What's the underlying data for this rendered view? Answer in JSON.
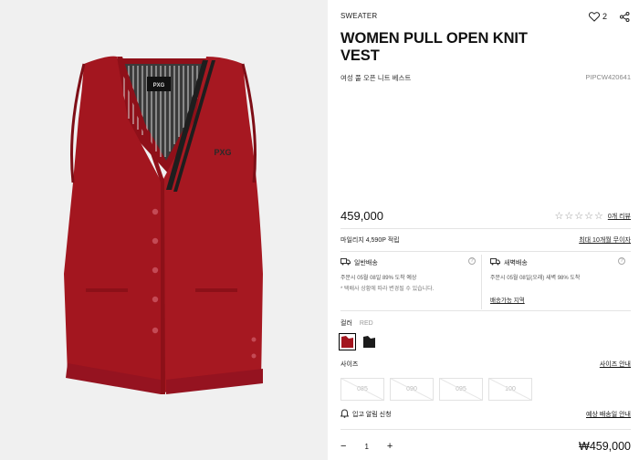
{
  "product": {
    "category": "SWEATER",
    "title": "WOMEN PULL OPEN KNIT VEST",
    "subtitle": "여성 풀 오픈 니트 베스트",
    "code": "PIPCW420641",
    "price": "459,000",
    "total_price": "₩459,000",
    "brand_label": "PXG",
    "tag_label": "PXG",
    "vest_color": "#a3161f",
    "dark_color": "#1e1e1e"
  },
  "actions": {
    "like_count": "2",
    "like_icon": "heart-icon",
    "share_icon": "share-icon"
  },
  "rating": {
    "stars": "☆☆☆☆☆",
    "review_link": "0개 리뷰"
  },
  "mileage": {
    "text": "마일리지 4,590P 적립",
    "installment_link": "최대 10개월 무이자"
  },
  "shipping": {
    "standard": {
      "title": "일반배송",
      "line": "주문시 05월 08일 89% 도착 예상",
      "note": "* 택배사 상황에 따라 변경될 수 있습니다."
    },
    "dawn": {
      "title": "새벽배송",
      "line": "주문시 05월 08일(오래) 새벽 98% 도착",
      "area_link": "배송가능 지역"
    }
  },
  "color": {
    "label": "컬러",
    "selected": "RED",
    "options": [
      "#a3161f",
      "#1c1c1c"
    ]
  },
  "size": {
    "label": "사이즈",
    "guide_link": "사이즈 안내",
    "options": [
      "085",
      "090",
      "095",
      "100"
    ]
  },
  "restock": {
    "label": "입고 알림 신청",
    "info_link": "예상 배송일 안내"
  },
  "quantity": {
    "minus": "−",
    "value": "1",
    "plus": "+"
  }
}
